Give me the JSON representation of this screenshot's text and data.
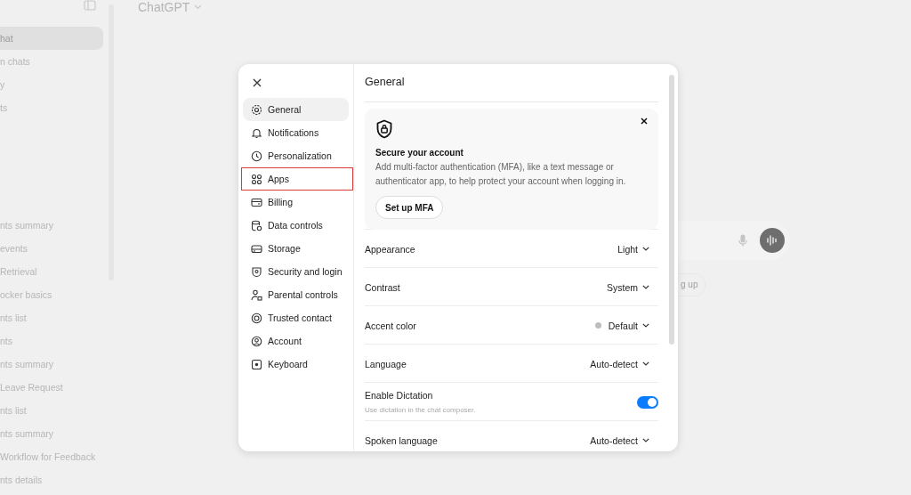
{
  "sidebar": {
    "top_items": [
      {
        "label": "hat",
        "selected": true
      },
      {
        "label": "n chats",
        "selected": false
      },
      {
        "label": "y",
        "selected": false
      },
      {
        "label": "ts",
        "selected": false
      }
    ],
    "history": [
      "nts summary",
      "events",
      "Retrieval",
      "ocker basics",
      "nts list",
      "nts",
      "nts summary",
      "Leave Request",
      "nts list",
      "nts summary",
      "Workflow for Feedback",
      "nts details"
    ]
  },
  "header": {
    "title": "ChatGPT"
  },
  "composer": {
    "suggestion": "g up"
  },
  "settings": {
    "nav": [
      {
        "label": "General",
        "selected": true,
        "highlighted": false
      },
      {
        "label": "Notifications",
        "selected": false,
        "highlighted": false
      },
      {
        "label": "Personalization",
        "selected": false,
        "highlighted": false
      },
      {
        "label": "Apps",
        "selected": false,
        "highlighted": true
      },
      {
        "label": "Billing",
        "selected": false,
        "highlighted": false
      },
      {
        "label": "Data controls",
        "selected": false,
        "highlighted": false
      },
      {
        "label": "Storage",
        "selected": false,
        "highlighted": false
      },
      {
        "label": "Security and login",
        "selected": false,
        "highlighted": false
      },
      {
        "label": "Parental controls",
        "selected": false,
        "highlighted": false
      },
      {
        "label": "Trusted contact",
        "selected": false,
        "highlighted": false
      },
      {
        "label": "Account",
        "selected": false,
        "highlighted": false
      },
      {
        "label": "Keyboard",
        "selected": false,
        "highlighted": false
      }
    ],
    "title": "General",
    "banner": {
      "title": "Secure your account",
      "text": "Add multi-factor authentication (MFA), like a text message or authenticator app, to help protect your account when logging in.",
      "button": "Set up MFA"
    },
    "rows": [
      {
        "kind": "select",
        "label": "Appearance",
        "value": "Light"
      },
      {
        "kind": "select",
        "label": "Contrast",
        "value": "System"
      },
      {
        "kind": "select",
        "label": "Accent color",
        "value": "Default",
        "dot": true
      },
      {
        "kind": "select",
        "label": "Language",
        "value": "Auto-detect"
      },
      {
        "kind": "toggle",
        "label": "Enable Dictation",
        "description": "Use dictation in the chat composer.",
        "on": true
      },
      {
        "kind": "select",
        "label": "Spoken language",
        "value": "Auto-detect"
      }
    ]
  }
}
